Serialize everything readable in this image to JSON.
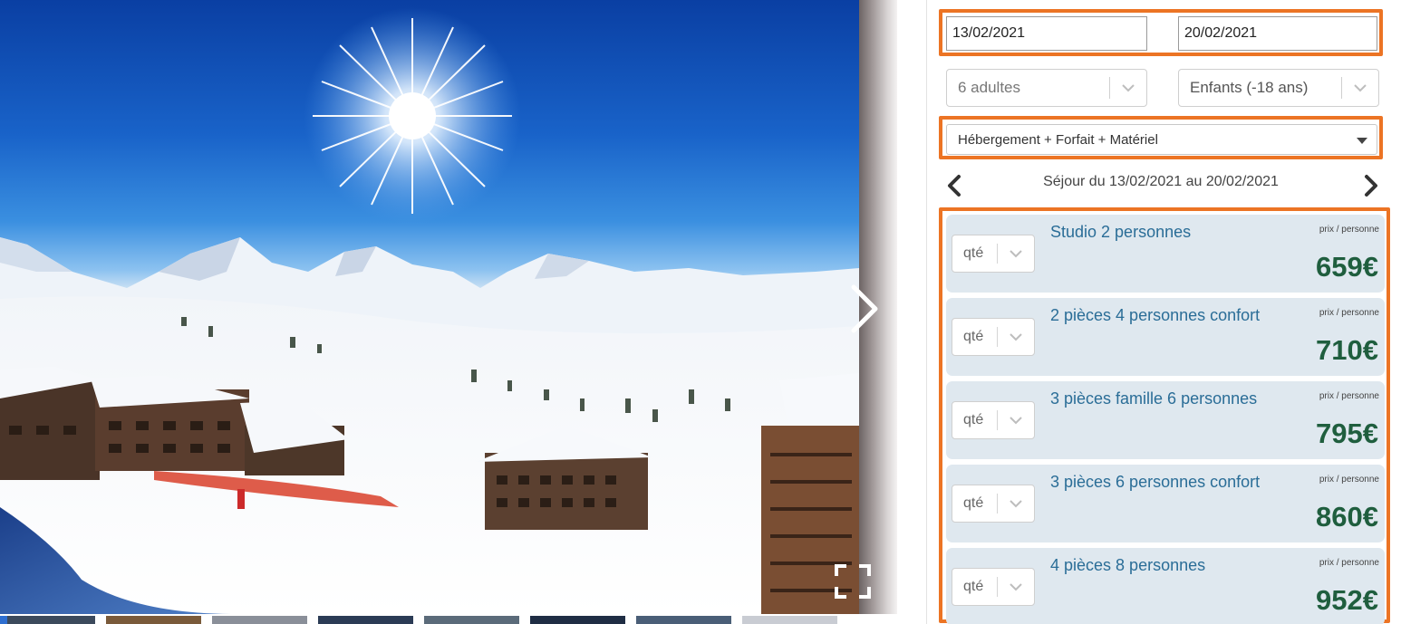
{
  "dates": {
    "start": "13/02/2021",
    "end": "20/02/2021"
  },
  "guests": {
    "adults": "6 adultes",
    "children": "Enfants (-18 ans)"
  },
  "formula": {
    "selected": "Hébergement + Forfait + Matériel"
  },
  "period": {
    "label": "Séjour du 13/02/2021 au 20/02/2021"
  },
  "offers": [
    {
      "qty_placeholder": "qté",
      "name": "Studio 2 personnes",
      "unit": "prix / personne",
      "price": "659€"
    },
    {
      "qty_placeholder": "qté",
      "name": "2 pièces 4 personnes confort",
      "unit": "prix / personne",
      "price": "710€"
    },
    {
      "qty_placeholder": "qté",
      "name": "3 pièces famille 6 personnes",
      "unit": "prix / personne",
      "price": "795€"
    },
    {
      "qty_placeholder": "qté",
      "name": "3 pièces 6 personnes confort",
      "unit": "prix / personne",
      "price": "860€"
    },
    {
      "qty_placeholder": "qté",
      "name": "4 pièces 8 personnes",
      "unit": "prix / personne",
      "price": "952€"
    }
  ],
  "icons": {
    "gallery_next": "chevron-right-icon",
    "fullscreen": "fullscreen-icon",
    "period_prev": "chevron-left-icon",
    "period_next": "chevron-right-icon",
    "select_chevron": "chevron-down-icon",
    "formula_caret": "caret-down-icon"
  },
  "colors": {
    "highlight": "#ec7424",
    "offer_bg": "#dfe8ef",
    "offer_name": "#2a6d97",
    "price": "#1f5e3e"
  }
}
